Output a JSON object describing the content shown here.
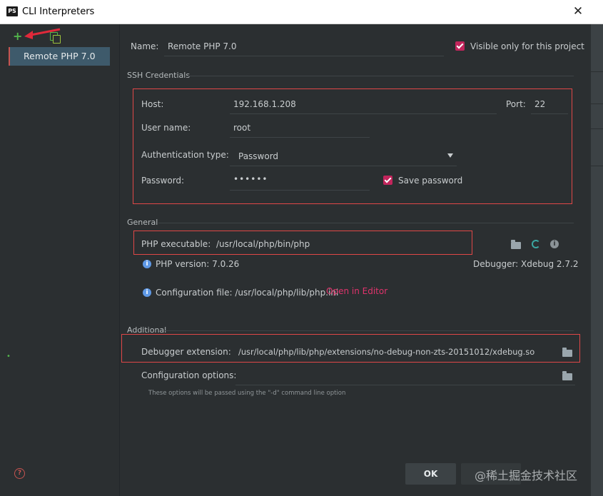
{
  "window": {
    "title": "CLI Interpreters",
    "icon_label": "PS"
  },
  "sidebar": {
    "items": [
      {
        "label": "Remote PHP 7.0",
        "selected": true
      }
    ]
  },
  "form": {
    "name_label": "Name:",
    "name_value": "Remote PHP 7.0",
    "visible_only_label": "Visible only for this project",
    "visible_only_checked": true
  },
  "ssh": {
    "section": "SSH Credentials",
    "host_label": "Host:",
    "host_value": "192.168.1.208",
    "port_label": "Port:",
    "port_value": "22",
    "username_label": "User name:",
    "username_value": "root",
    "auth_type_label": "Authentication type:",
    "auth_type_value": "Password",
    "password_label": "Password:",
    "password_value": "••••••",
    "save_password_label": "Save password",
    "save_password_checked": true
  },
  "general": {
    "section": "General",
    "php_executable_label": "PHP executable:",
    "php_executable_value": "/usr/local/php/bin/php",
    "php_version_text": "PHP version: 7.0.26",
    "debugger_text": "Debugger:  Xdebug 2.7.2",
    "config_file_text": "Configuration file: /usr/local/php/lib/php.ini",
    "open_in_editor": "Open in Editor"
  },
  "additional": {
    "section": "Additional",
    "debugger_ext_label": "Debugger extension:",
    "debugger_ext_value": "/usr/local/php/lib/php/extensions/no-debug-non-zts-20151012/xdebug.so",
    "config_options_label": "Configuration options:",
    "config_options_hint": "These options will be passed using the \"-d\" command line option"
  },
  "buttons": {
    "ok": "OK"
  },
  "watermark": "@稀土掘金技术社区",
  "colors": {
    "accent_red": "#e04747",
    "checkbox": "#c2255c",
    "link": "#e0336c",
    "selection": "#3e5a6b",
    "add_green": "#52b54b"
  }
}
